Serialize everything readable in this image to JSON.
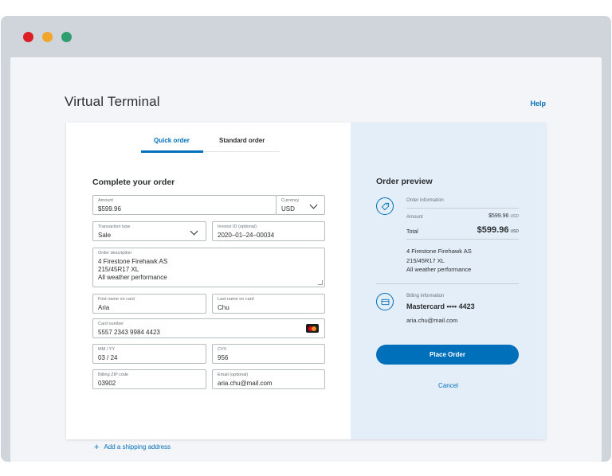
{
  "page": {
    "title": "Virtual Terminal",
    "help": "Help"
  },
  "tabs": {
    "quick": "Quick order",
    "standard": "Standard order"
  },
  "form": {
    "section_title": "Complete your order",
    "amount": {
      "label": "Amount",
      "value": "$599.96"
    },
    "currency": {
      "label": "Currency",
      "value": "USD"
    },
    "transaction_type": {
      "label": "Transaction type",
      "value": "Sale"
    },
    "invoice_id": {
      "label": "Invoice ID (optional)",
      "value": "2020–01–24–00034"
    },
    "order_description": {
      "label": "Order description",
      "value": "4 Firestone Firehawk AS\n215/45R17 XL\nAll weather performance"
    },
    "first_name": {
      "label": "First name on card",
      "value": "Aria"
    },
    "last_name": {
      "label": "Last name on card",
      "value": "Chu"
    },
    "card_number": {
      "label": "Card number",
      "value": "5557 2343 9984 4423",
      "brand_icon": "mastercard-icon"
    },
    "expiry": {
      "label": "MM / YY",
      "value": "03 / 24"
    },
    "cvv": {
      "label": "CVV",
      "value": "956"
    },
    "zip": {
      "label": "Billing ZIP code",
      "value": "03902"
    },
    "email": {
      "label": "Email (optional)",
      "value": "aria.chu@mail.com"
    },
    "add_shipping": "Add a shipping address"
  },
  "preview": {
    "title": "Order preview",
    "order_info_label": "Order information",
    "amount_label": "Amount",
    "amount_value": "$599.96",
    "amount_currency": "USD",
    "total_label": "Total",
    "total_value": "$599.96",
    "total_currency": "USD",
    "description": "4 Firestone Firehawk AS\n215/45R17 XL\nAll weather performance",
    "billing_label": "Billing information",
    "card_display": "Mastercard •••• 4423",
    "email": "aria.chu@mail.com",
    "place_order": "Place Order",
    "cancel": "Cancel"
  },
  "colors": {
    "accent": "#0070ba",
    "preview_bg": "#e3eef9",
    "frame": "#cfd5da"
  }
}
